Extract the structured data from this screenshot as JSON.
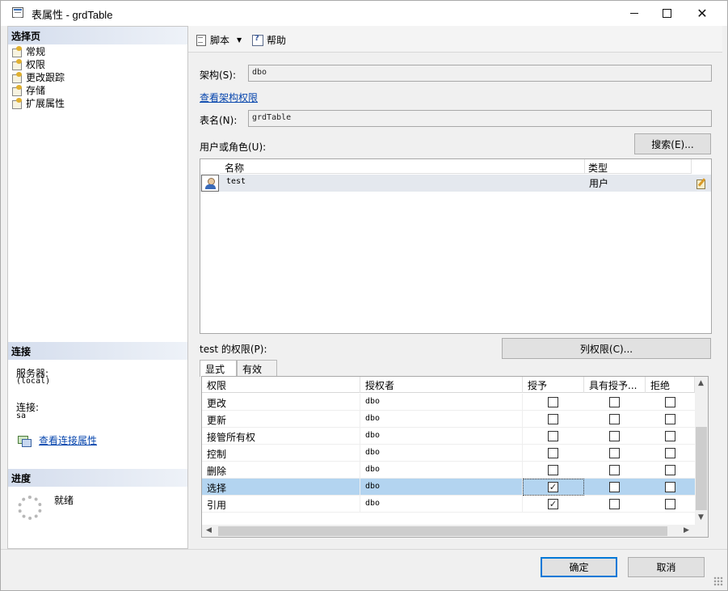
{
  "window": {
    "title": "表属性 - grdTable",
    "minimize": "–",
    "maximize": "□",
    "close": "✕"
  },
  "left": {
    "select_page_header": "选择页",
    "pages": [
      {
        "label": "常规",
        "icon": "page-icon"
      },
      {
        "label": "权限",
        "icon": "page-icon"
      },
      {
        "label": "更改跟踪",
        "icon": "page-icon"
      },
      {
        "label": "存储",
        "icon": "page-icon"
      },
      {
        "label": "扩展属性",
        "icon": "page-icon"
      }
    ],
    "connection_header": "连接",
    "server_label": "服务器:",
    "server_value": "(local)",
    "connection_label": "连接:",
    "connection_value": "sa",
    "view_connection_link": "查看连接属性",
    "progress_header": "进度",
    "progress_status": "就绪"
  },
  "toolbar": {
    "script_label": "脚本",
    "help_label": "帮助"
  },
  "form": {
    "schema_label": "架构(S):",
    "schema_value": "dbo",
    "view_schema_perms_link": "查看架构权限",
    "table_name_label": "表名(N):",
    "table_name_value": "grdTable",
    "users_roles_label": "用户或角色(U):",
    "search_button": "搜索(E)..."
  },
  "users_grid": {
    "columns": [
      "名称",
      "类型"
    ],
    "rows": [
      {
        "name": "test",
        "type": "用户",
        "icon": "user-icon"
      }
    ]
  },
  "permissions": {
    "label": "test 的权限(P):",
    "column_perms_button": "列权限(C)...",
    "tabs": [
      "显式",
      "有效"
    ],
    "columns": [
      "权限",
      "授权者",
      "授予",
      "具有授予...",
      "拒绝"
    ],
    "rows": [
      {
        "permission": "更改",
        "grantor": "dbo",
        "grant": false,
        "with_grant": false,
        "deny": false
      },
      {
        "permission": "更新",
        "grantor": "dbo",
        "grant": false,
        "with_grant": false,
        "deny": false
      },
      {
        "permission": "接管所有权",
        "grantor": "dbo",
        "grant": false,
        "with_grant": false,
        "deny": false
      },
      {
        "permission": "控制",
        "grantor": "dbo",
        "grant": false,
        "with_grant": false,
        "deny": false
      },
      {
        "permission": "删除",
        "grantor": "dbo",
        "grant": false,
        "with_grant": false,
        "deny": false
      },
      {
        "permission": "选择",
        "grantor": "dbo",
        "grant": true,
        "with_grant": false,
        "deny": false,
        "selected": true
      },
      {
        "permission": "引用",
        "grantor": "dbo",
        "grant": true,
        "with_grant": false,
        "deny": false
      }
    ]
  },
  "footer": {
    "ok_button": "确定",
    "cancel_button": "取消"
  },
  "colors": {
    "selected_row": "#b3d4f0",
    "link": "#0645ad",
    "section_header": "#d4dded"
  }
}
